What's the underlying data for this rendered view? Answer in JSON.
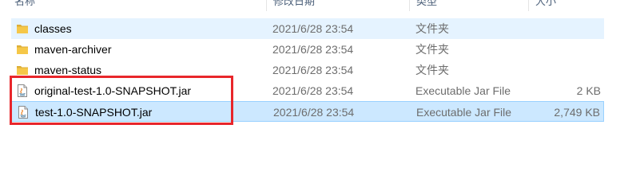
{
  "columns": {
    "name": "名称",
    "date": "修改日期",
    "type": "类型",
    "size": "大小"
  },
  "files": [
    {
      "name": "classes",
      "date": "2021/6/28 23:54",
      "type": "文件夹",
      "size": "",
      "icon": "folder-icon"
    },
    {
      "name": "maven-archiver",
      "date": "2021/6/28 23:54",
      "type": "文件夹",
      "size": "",
      "icon": "folder-icon"
    },
    {
      "name": "maven-status",
      "date": "2021/6/28 23:54",
      "type": "文件夹",
      "size": "",
      "icon": "folder-icon"
    },
    {
      "name": "original-test-1.0-SNAPSHOT.jar",
      "date": "2021/6/28 23:54",
      "type": "Executable Jar File",
      "size": "2 KB",
      "icon": "jar-file-icon"
    },
    {
      "name": "test-1.0-SNAPSHOT.jar",
      "date": "2021/6/28 23:54",
      "type": "Executable Jar File",
      "size": "2,749 KB",
      "icon": "jar-file-icon"
    }
  ],
  "colors": {
    "annotation_box": "#e8262b",
    "selection": "#cce8ff",
    "hover": "#e5f3ff",
    "folder": "#f5c748"
  }
}
